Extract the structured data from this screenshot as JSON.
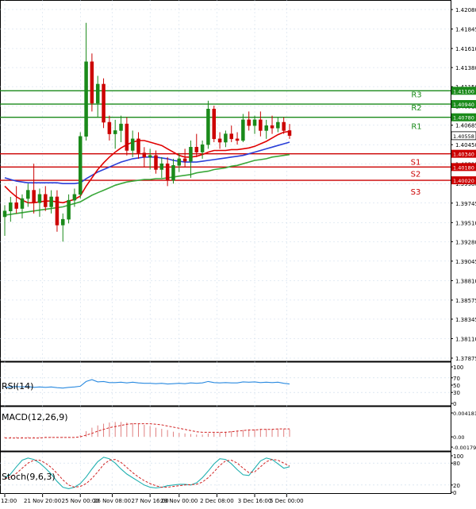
{
  "chart_data": {
    "type": "candlestick",
    "instrument_prices": {
      "y_ticks": [
        "1.42080",
        "1.41845",
        "1.41610",
        "1.41380",
        "1.41150",
        "1.40915",
        "1.40685",
        "1.40450",
        "1.40215",
        "1.39980",
        "1.39745",
        "1.39510",
        "1.39280",
        "1.39045",
        "1.38810",
        "1.38575",
        "1.38345",
        "1.38110",
        "1.37875"
      ],
      "y_tick_values": [
        1.4208,
        1.41845,
        1.4161,
        1.4138,
        1.4115,
        1.40915,
        1.40685,
        1.4045,
        1.40215,
        1.3998,
        1.39745,
        1.3951,
        1.3928,
        1.39045,
        1.3881,
        1.38575,
        1.38345,
        1.3811,
        1.37875
      ],
      "ylim": [
        1.3776,
        1.4224
      ],
      "current_price": "1.40558",
      "current_price_value": 1.40558,
      "levels": [
        {
          "name": "R3",
          "value": 1.411,
          "label": "1.41100",
          "color": "#1a8a1a"
        },
        {
          "name": "R2",
          "value": 1.4094,
          "label": "1.40940",
          "color": "#1a8a1a"
        },
        {
          "name": "R1",
          "value": 1.4078,
          "label": "1.40780",
          "color": "#1a8a1a"
        },
        {
          "name": "S1",
          "value": 1.4034,
          "label": "1.40340",
          "color": "#cc0000"
        },
        {
          "name": "S2",
          "value": 1.4018,
          "label": "1.40180",
          "color": "#cc0000"
        },
        {
          "name": "S3",
          "value": 1.4002,
          "label": "1.40020",
          "color": "#cc0000"
        }
      ],
      "level_text_values": {
        "R3": "1.41100",
        "R2": "1.40940",
        "R1": "1.40780",
        "S1": "1.40340",
        "S2": "1.40180",
        "S3": "1.40020"
      },
      "candles": [
        {
          "o": 1.3958,
          "h": 1.3972,
          "l": 1.3935,
          "c": 1.3965
        },
        {
          "o": 1.3965,
          "h": 1.3982,
          "l": 1.3952,
          "c": 1.3975
        },
        {
          "o": 1.3975,
          "h": 1.3995,
          "l": 1.3962,
          "c": 1.3968
        },
        {
          "o": 1.3968,
          "h": 1.3985,
          "l": 1.3956,
          "c": 1.398
        },
        {
          "o": 1.398,
          "h": 1.3998,
          "l": 1.397,
          "c": 1.399
        },
        {
          "o": 1.399,
          "h": 1.4022,
          "l": 1.3962,
          "c": 1.3975
        },
        {
          "o": 1.3975,
          "h": 1.3992,
          "l": 1.3958,
          "c": 1.3985
        },
        {
          "o": 1.3985,
          "h": 1.3995,
          "l": 1.3965,
          "c": 1.397
        },
        {
          "o": 1.397,
          "h": 1.399,
          "l": 1.3962,
          "c": 1.3982
        },
        {
          "o": 1.3982,
          "h": 1.399,
          "l": 1.394,
          "c": 1.3948
        },
        {
          "o": 1.3948,
          "h": 1.3962,
          "l": 1.3928,
          "c": 1.3955
        },
        {
          "o": 1.3955,
          "h": 1.3985,
          "l": 1.395,
          "c": 1.3978
        },
        {
          "o": 1.3978,
          "h": 1.3992,
          "l": 1.397,
          "c": 1.3985
        },
        {
          "o": 1.3985,
          "h": 1.406,
          "l": 1.398,
          "c": 1.4055
        },
        {
          "o": 1.4055,
          "h": 1.4192,
          "l": 1.405,
          "c": 1.4145
        },
        {
          "o": 1.4145,
          "h": 1.4155,
          "l": 1.4085,
          "c": 1.4095
        },
        {
          "o": 1.4095,
          "h": 1.4128,
          "l": 1.4078,
          "c": 1.4118
        },
        {
          "o": 1.4118,
          "h": 1.4125,
          "l": 1.4065,
          "c": 1.4072
        },
        {
          "o": 1.4072,
          "h": 1.408,
          "l": 1.405,
          "c": 1.4058
        },
        {
          "o": 1.4058,
          "h": 1.4075,
          "l": 1.404,
          "c": 1.4062
        },
        {
          "o": 1.4062,
          "h": 1.408,
          "l": 1.4048,
          "c": 1.407
        },
        {
          "o": 1.407,
          "h": 1.4078,
          "l": 1.4032,
          "c": 1.4038
        },
        {
          "o": 1.4038,
          "h": 1.4062,
          "l": 1.403,
          "c": 1.4052
        },
        {
          "o": 1.4052,
          "h": 1.406,
          "l": 1.4028,
          "c": 1.4035
        },
        {
          "o": 1.4035,
          "h": 1.4042,
          "l": 1.4018,
          "c": 1.403
        },
        {
          "o": 1.403,
          "h": 1.404,
          "l": 1.4015,
          "c": 1.4032
        },
        {
          "o": 1.4032,
          "h": 1.4038,
          "l": 1.401,
          "c": 1.4015
        },
        {
          "o": 1.4015,
          "h": 1.403,
          "l": 1.4005,
          "c": 1.4022
        },
        {
          "o": 1.4022,
          "h": 1.403,
          "l": 1.3995,
          "c": 1.4002
        },
        {
          "o": 1.4002,
          "h": 1.4028,
          "l": 1.3998,
          "c": 1.402
        },
        {
          "o": 1.402,
          "h": 1.4035,
          "l": 1.4012,
          "c": 1.4028
        },
        {
          "o": 1.4028,
          "h": 1.404,
          "l": 1.4018,
          "c": 1.4025
        },
        {
          "o": 1.4025,
          "h": 1.405,
          "l": 1.4005,
          "c": 1.4042
        },
        {
          "o": 1.4042,
          "h": 1.4058,
          "l": 1.403,
          "c": 1.4036
        },
        {
          "o": 1.4036,
          "h": 1.405,
          "l": 1.4028,
          "c": 1.4045
        },
        {
          "o": 1.4045,
          "h": 1.4098,
          "l": 1.404,
          "c": 1.4088
        },
        {
          "o": 1.4088,
          "h": 1.4092,
          "l": 1.4048,
          "c": 1.4052
        },
        {
          "o": 1.4052,
          "h": 1.406,
          "l": 1.404,
          "c": 1.4048
        },
        {
          "o": 1.4048,
          "h": 1.4062,
          "l": 1.4042,
          "c": 1.4058
        },
        {
          "o": 1.4058,
          "h": 1.4068,
          "l": 1.4048,
          "c": 1.4052
        },
        {
          "o": 1.4052,
          "h": 1.406,
          "l": 1.4045,
          "c": 1.405
        },
        {
          "o": 1.405,
          "h": 1.4082,
          "l": 1.4048,
          "c": 1.4075
        },
        {
          "o": 1.4075,
          "h": 1.4085,
          "l": 1.4062,
          "c": 1.4068
        },
        {
          "o": 1.4068,
          "h": 1.408,
          "l": 1.4058,
          "c": 1.4075
        },
        {
          "o": 1.4075,
          "h": 1.4085,
          "l": 1.4055,
          "c": 1.4062
        },
        {
          "o": 1.4062,
          "h": 1.4075,
          "l": 1.4052,
          "c": 1.4068
        },
        {
          "o": 1.4068,
          "h": 1.408,
          "l": 1.4058,
          "c": 1.4065
        },
        {
          "o": 1.4065,
          "h": 1.4078,
          "l": 1.406,
          "c": 1.4072
        },
        {
          "o": 1.4072,
          "h": 1.4078,
          "l": 1.4058,
          "c": 1.4062
        },
        {
          "o": 1.4062,
          "h": 1.407,
          "l": 1.4052,
          "c": 1.4056
        }
      ],
      "ma_red": [
        1.3995,
        1.3988,
        1.3982,
        1.3978,
        1.3975,
        1.3975,
        1.3976,
        1.3977,
        1.3977,
        1.3976,
        1.3975,
        1.3977,
        1.3979,
        1.3983,
        1.3995,
        1.4005,
        1.4015,
        1.4023,
        1.403,
        1.4036,
        1.4041,
        1.4045,
        1.4048,
        1.405,
        1.405,
        1.4048,
        1.4046,
        1.4044,
        1.404,
        1.4036,
        1.4032,
        1.403,
        1.403,
        1.4031,
        1.4033,
        1.4036,
        1.4038,
        1.4038,
        1.4038,
        1.4039,
        1.4039,
        1.404,
        1.4041,
        1.4043,
        1.4046,
        1.4049,
        1.4053,
        1.4057,
        1.406,
        1.4061
      ],
      "ma_blue": [
        1.4005,
        1.4003,
        1.4001,
        1.4,
        1.3999,
        1.3999,
        1.3999,
        1.3999,
        1.3999,
        1.3999,
        1.3998,
        1.3998,
        1.3998,
        1.3999,
        1.4004,
        1.4008,
        1.4012,
        1.4015,
        1.4018,
        1.4021,
        1.4024,
        1.4026,
        1.4028,
        1.4029,
        1.403,
        1.403,
        1.403,
        1.4029,
        1.4028,
        1.4026,
        1.4025,
        1.4024,
        1.4024,
        1.4024,
        1.4025,
        1.4026,
        1.4027,
        1.4028,
        1.4029,
        1.403,
        1.4031,
        1.4032,
        1.4034,
        1.4036,
        1.4038,
        1.404,
        1.4042,
        1.4044,
        1.4046,
        1.4048
      ],
      "ma_green": [
        1.396,
        1.3961,
        1.3962,
        1.3963,
        1.3964,
        1.3965,
        1.3966,
        1.3967,
        1.3968,
        1.3969,
        1.397,
        1.3972,
        1.3974,
        1.3976,
        1.398,
        1.3984,
        1.3987,
        1.399,
        1.3993,
        1.3996,
        1.3998,
        1.4,
        1.4001,
        1.4002,
        1.4003,
        1.4003,
        1.4004,
        1.4004,
        1.4005,
        1.4006,
        1.4007,
        1.4008,
        1.4009,
        1.4011,
        1.4012,
        1.4013,
        1.4015,
        1.4016,
        1.4017,
        1.4019,
        1.402,
        1.4022,
        1.4024,
        1.4026,
        1.4027,
        1.4028,
        1.403,
        1.4031,
        1.4032,
        1.4033
      ]
    },
    "rsi": {
      "label": "RSI(14)",
      "y_ticks": [
        "100",
        "70",
        "50",
        "30",
        "0"
      ],
      "y_tick_values": [
        100,
        70,
        50,
        30,
        0
      ],
      "ylim": [
        0,
        100
      ],
      "values": [
        44,
        45,
        46,
        45,
        46,
        44,
        45,
        44,
        45,
        43,
        42,
        44,
        45,
        47,
        60,
        65,
        59,
        60,
        57,
        57,
        58,
        56,
        58,
        56,
        55,
        55,
        54,
        55,
        53,
        54,
        55,
        54,
        56,
        55,
        56,
        60,
        57,
        56,
        57,
        56,
        56,
        59,
        58,
        59,
        57,
        58,
        57,
        58,
        55,
        53
      ]
    },
    "macd": {
      "label": "MACD(12,26,9)",
      "y_ticks": [
        "0.004181",
        "0.00",
        "-0.001794"
      ],
      "y_tick_values": [
        0.004181,
        0.0,
        -0.001794
      ],
      "ylim": [
        -0.0022,
        0.0046
      ],
      "histogram": [
        -0.0002,
        -0.0002,
        -0.0002,
        -0.0002,
        -0.0002,
        -0.0001,
        -0.0001,
        -0.0001,
        -0.0001,
        -0.0001,
        -0.0001,
        -0.0001,
        0.0,
        0.0003,
        0.001,
        0.0016,
        0.002,
        0.0023,
        0.0025,
        0.0026,
        0.0026,
        0.0025,
        0.0024,
        0.0023,
        0.0021,
        0.0019,
        0.0016,
        0.0014,
        0.0012,
        0.0009,
        0.0007,
        0.0006,
        0.0005,
        0.0004,
        0.0004,
        0.0006,
        0.0007,
        0.0008,
        0.0009,
        0.001,
        0.0011,
        0.0012,
        0.0013,
        0.0013,
        0.0014,
        0.0014,
        0.0014,
        0.0014,
        0.0014,
        0.0013
      ],
      "signal": [
        -0.0002,
        -0.0002,
        -0.0002,
        -0.0002,
        -0.0002,
        -0.0002,
        -0.0002,
        -0.0001,
        -0.0001,
        -0.0001,
        -0.0001,
        -0.0001,
        -0.0001,
        0.0,
        0.0003,
        0.0006,
        0.001,
        0.0013,
        0.0016,
        0.0018,
        0.002,
        0.0022,
        0.0023,
        0.0023,
        0.0023,
        0.0023,
        0.0022,
        0.0021,
        0.0019,
        0.0017,
        0.0015,
        0.0013,
        0.0011,
        0.0009,
        0.0008,
        0.0008,
        0.0008,
        0.0008,
        0.0008,
        0.0009,
        0.001,
        0.0011,
        0.0012,
        0.0012,
        0.0013,
        0.0013,
        0.0013,
        0.0014,
        0.0014,
        0.0014
      ]
    },
    "stoch": {
      "label": "Stoch(9,6,3)",
      "y_ticks": [
        "100",
        "80",
        "20",
        "0"
      ],
      "y_tick_values": [
        100,
        80,
        20,
        0
      ],
      "ylim": [
        0,
        100
      ],
      "main": [
        40,
        50,
        70,
        88,
        94,
        90,
        80,
        66,
        50,
        30,
        14,
        10,
        14,
        24,
        42,
        64,
        84,
        96,
        92,
        80,
        64,
        50,
        40,
        30,
        20,
        14,
        12,
        14,
        18,
        20,
        22,
        22,
        20,
        26,
        40,
        58,
        78,
        92,
        90,
        78,
        62,
        48,
        46,
        66,
        86,
        94,
        90,
        78,
        66,
        70
      ],
      "signal": [
        38,
        42,
        52,
        66,
        80,
        88,
        88,
        80,
        68,
        52,
        34,
        20,
        14,
        16,
        24,
        38,
        56,
        76,
        88,
        90,
        82,
        68,
        54,
        42,
        32,
        24,
        18,
        14,
        14,
        16,
        18,
        20,
        21,
        22,
        28,
        40,
        56,
        74,
        86,
        88,
        80,
        66,
        54,
        56,
        70,
        84,
        90,
        88,
        80,
        72
      ]
    },
    "x_labels": [
      "12:00",
      "21 Nov 20:00",
      "25 Nov 00:00",
      "26 Nov 08:00",
      "27 Nov 16:00",
      "29 Nov 00:00",
      "2 Dec 08:00",
      "3 Dec 16:00",
      "5 Dec 00:00"
    ],
    "x_label_index": [
      0,
      6.5,
      13,
      18.5,
      25,
      30,
      36.5,
      43,
      48.5
    ]
  },
  "colors": {
    "bull": "#1a8a1a",
    "bear": "#cc0000",
    "ma_red": "#e00000",
    "ma_blue": "#2a3fd8",
    "ma_green": "#3aa83a",
    "rsi_line": "#2a8ae0",
    "macd_hist": "#e08080",
    "macd_signal": "#d02020",
    "stoch_main": "#20b0b0",
    "stoch_signal": "#d02020",
    "grid": "#c8d8e8"
  }
}
